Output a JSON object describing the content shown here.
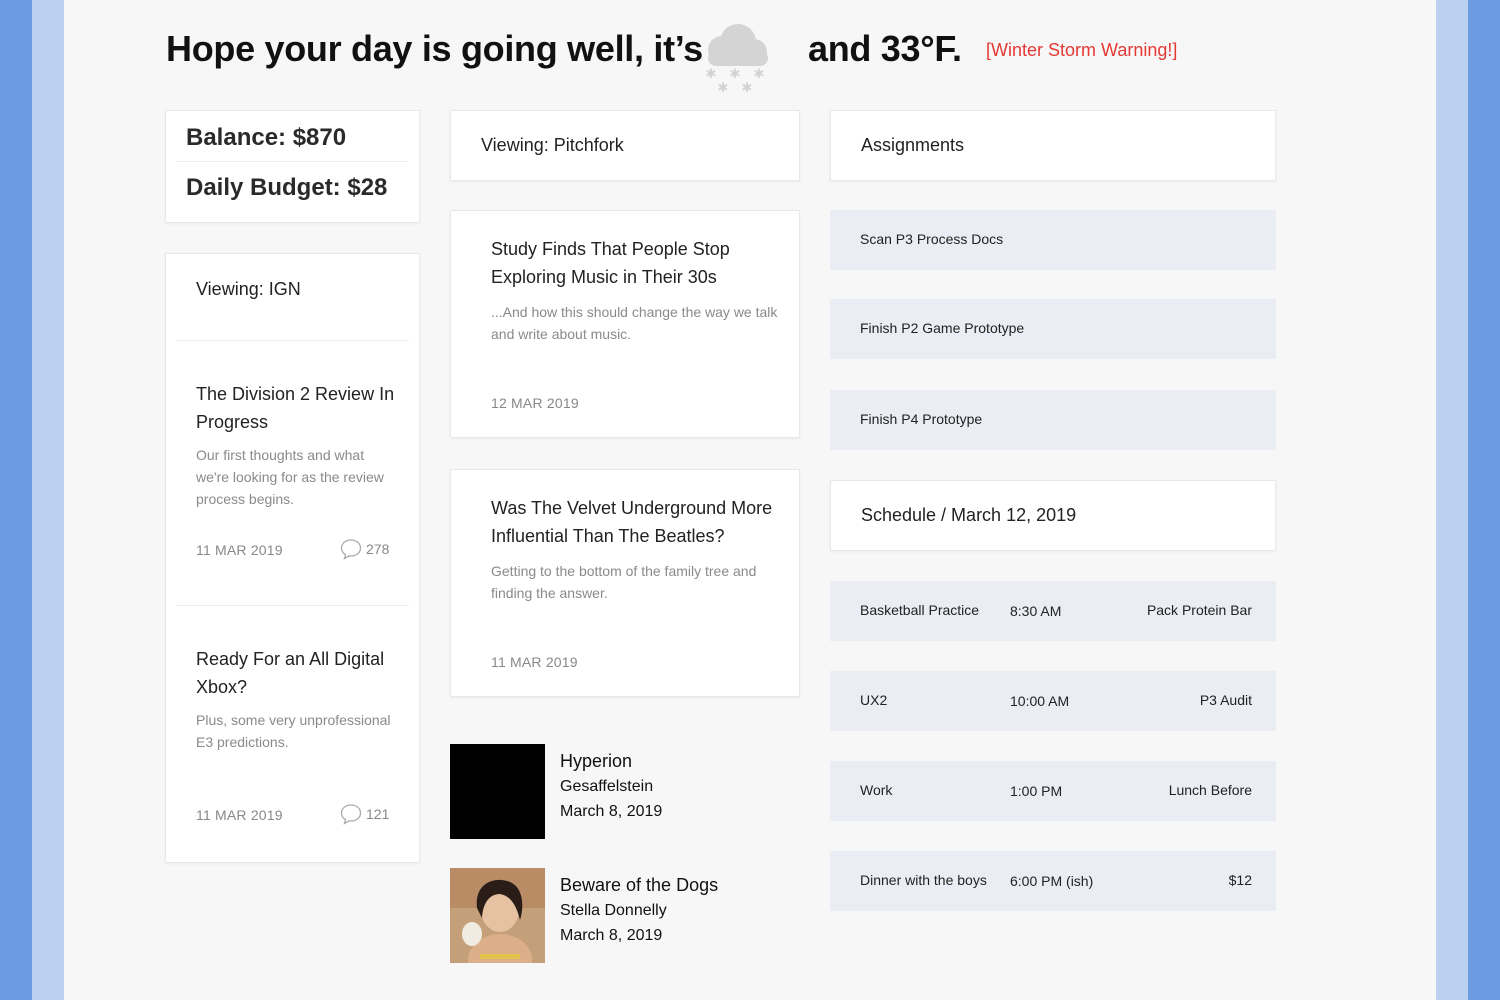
{
  "header": {
    "greeting_part1": "Hope your day is going well, it’s",
    "weather_icon": "snow-cloud-icon",
    "greeting_part2": "and 33°F.",
    "alert": "[Winter Storm Warning!]",
    "alert_color": "#e53935"
  },
  "finance": {
    "balance": "Balance: $870",
    "daily_budget": "Daily Budget: $28"
  },
  "ign": {
    "heading": "Viewing: IGN",
    "articles": [
      {
        "title": "The Division 2 Review In Progress",
        "summary": "Our first thoughts and what we're looking for as the review process begins.",
        "date": "11 MAR 2019",
        "comments": "278"
      },
      {
        "title": "Ready For an All Digital Xbox?",
        "summary": "Plus, some very unprofessional E3 predictions.",
        "date": "11 MAR 2019",
        "comments": "121"
      }
    ]
  },
  "pitchfork": {
    "heading": "Viewing: Pitchfork",
    "articles": [
      {
        "title": "Study Finds That People Stop Exploring Music in Their 30s",
        "summary": "...And how this should change the way we talk and write about music.",
        "date": "12 MAR 2019"
      },
      {
        "title": "Was The Velvet Underground More Influential Than The Beatles?",
        "summary": "Getting to the bottom of the family tree and finding the answer.",
        "date": "11 MAR 2019"
      }
    ]
  },
  "albums": [
    {
      "title": "Hyperion",
      "artist": "Gesaffelstein",
      "date": "March 8, 2019"
    },
    {
      "title": "Beware of the Dogs",
      "artist": "Stella Donnelly",
      "date": "March 8, 2019"
    }
  ],
  "assignments": {
    "heading": "Assignments",
    "items": [
      "Scan P3 Process Docs",
      "Finish P2 Game Prototype",
      "Finish P4 Prototype"
    ]
  },
  "schedule": {
    "heading": "Schedule / March 12, 2019",
    "items": [
      {
        "event": "Basketball Practice",
        "time": "8:30 AM",
        "note": "Pack Protein Bar"
      },
      {
        "event": "UX2",
        "time": "10:00 AM",
        "note": "P3 Audit"
      },
      {
        "event": "Work",
        "time": "1:00 PM",
        "note": "Lunch Before"
      },
      {
        "event": "Dinner with the boys",
        "time": "6:00 PM (ish)",
        "note": "$12"
      }
    ]
  },
  "colors": {
    "edge_dark": "#6d9be3",
    "edge_light": "#bcd1f0",
    "row_bg": "#eaedf3"
  }
}
